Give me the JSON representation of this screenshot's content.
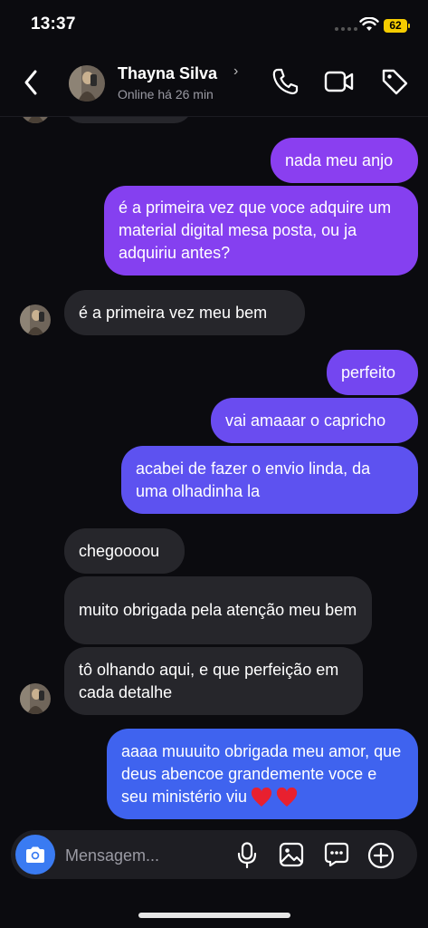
{
  "status_bar": {
    "time": "13:37",
    "battery": "62"
  },
  "header": {
    "contact_name": "Thayna Silva",
    "chevron": "›",
    "status": "Online há 26 min",
    "icons": [
      "back-icon",
      "phone-icon",
      "video-call-icon",
      "tag-icon"
    ]
  },
  "messages": [
    {
      "dir": "in",
      "text": ""
    },
    {
      "dir": "out",
      "text": "nada meu anjo"
    },
    {
      "dir": "out",
      "text": "é a primeira vez que voce adquire um material digital mesa posta, ou ja adquiriu antes?"
    },
    {
      "dir": "in",
      "text": "é a primeira vez meu bem"
    },
    {
      "dir": "out",
      "text": "perfeito"
    },
    {
      "dir": "out",
      "text": "vai amaaar o capricho"
    },
    {
      "dir": "out",
      "text": "acabei de fazer o envio linda, da uma olhadinha la"
    },
    {
      "dir": "in",
      "text": "chegoooou"
    },
    {
      "dir": "in",
      "text": "muito obrigada pela atenção meu bem"
    },
    {
      "dir": "in",
      "text": "tô olhando aqui, e que perfeição em cada detalhe"
    },
    {
      "dir": "out",
      "text": "aaaa muuuito obrigada meu amor, que deus abencoe grandemente voce e seu ministério viu",
      "emoji": "heart-icon x2"
    }
  ],
  "composer": {
    "placeholder": "Mensagem...",
    "icons": [
      "camera-icon",
      "microphone-icon",
      "gallery-icon",
      "sticker-icon",
      "plus-icon"
    ]
  },
  "colors": {
    "background": "#0b0b0f",
    "incoming_bubble": "#26262b",
    "outgoing_top": "#8a3ff0",
    "outgoing_mid": "#6a4ef0",
    "outgoing_bottom": "#3f63ef",
    "accent_blue": "#3a7bf2"
  }
}
